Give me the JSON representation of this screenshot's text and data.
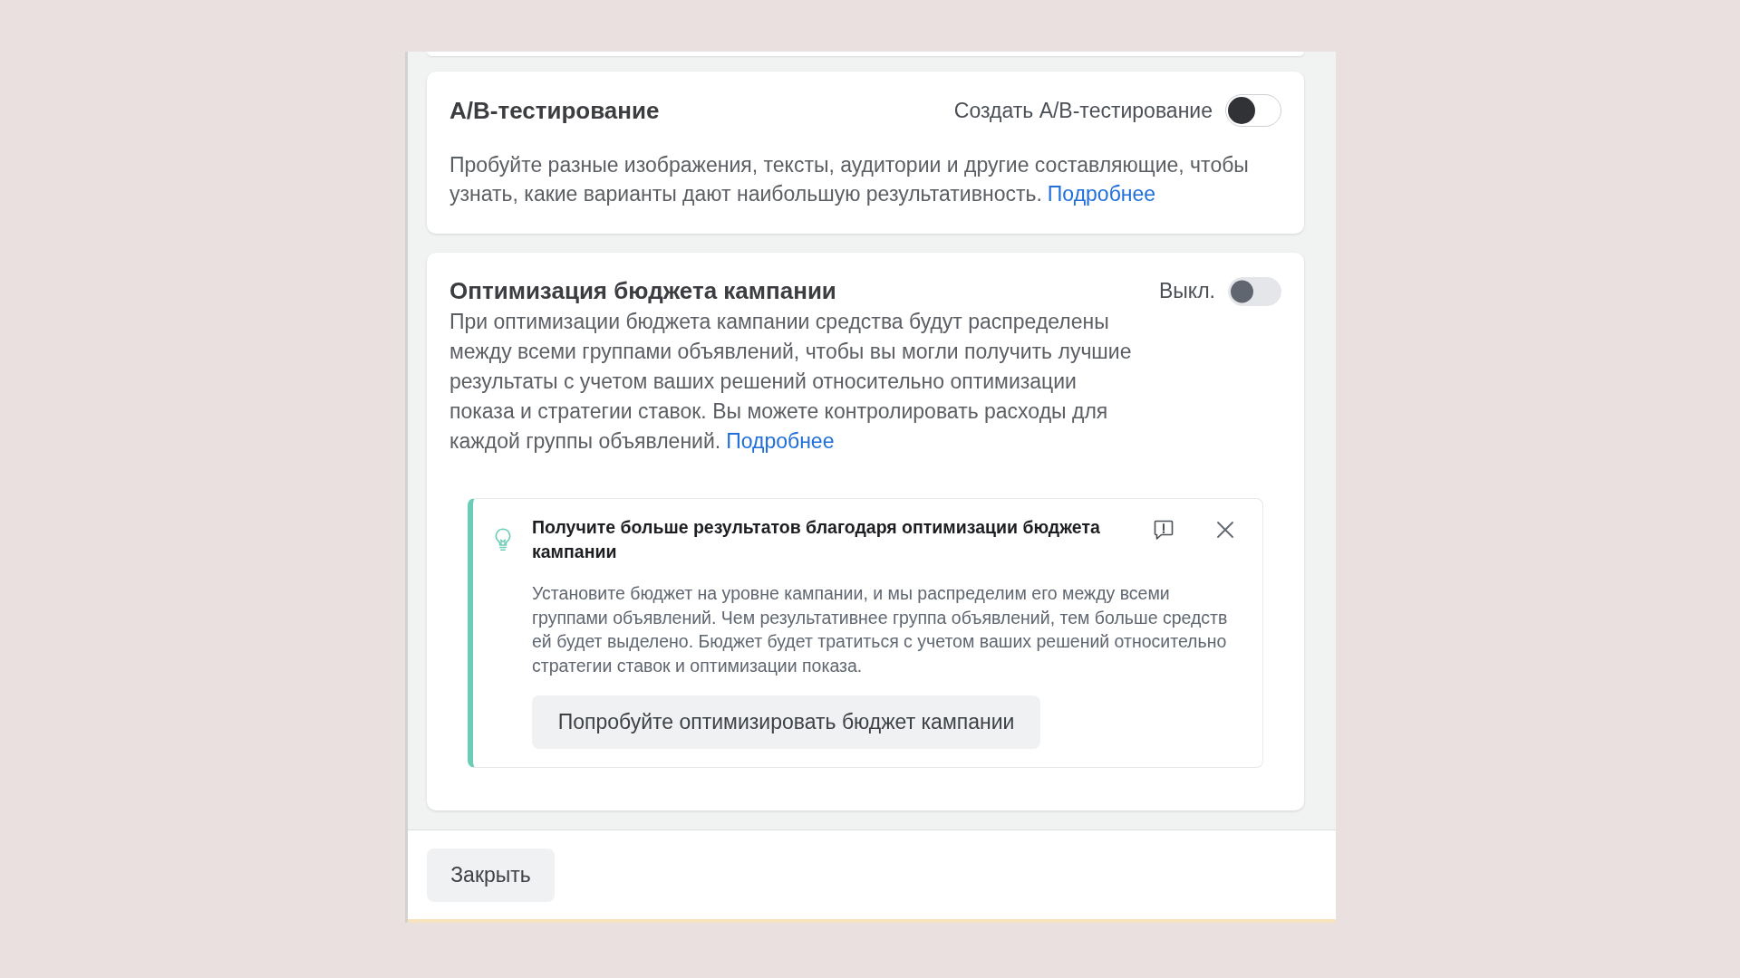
{
  "sections": [
    {
      "kind": "header_row",
      "title": "А/В-тестирование",
      "toggle_label": "Создать А/В-тестирование",
      "toggle_on": false,
      "disabled": false,
      "description": "Пробуйте разные изображения, тексты, аудитории и другие составляющие, чтобы узнать, какие варианты дают наибольшую результативность.",
      "link": "Подробнее"
    },
    {
      "kind": "side_toggle",
      "title": "Оптимизация бюджета кампании",
      "toggle_label": "Выкл.",
      "toggle_on": false,
      "disabled": true,
      "description": "При оптимизации бюджета кампании средства будут распределены между всеми группами объявлений, чтобы вы могли получить лучшие результаты с учетом ваших решений относительно оптимизации показа и стратегии ставок. Вы можете контролировать расходы для каждой группы объявлений.",
      "link": "Подробнее",
      "tip": {
        "title": "Получите больше результатов благодаря оптимизации бюджета кампании",
        "body": "Установите бюджет на уровне кампании, и мы распределим его между всеми группами объявлений. Чем результативнее группа объявлений, тем больше средств ей будет выделено. Бюджет будет тратиться с учетом ваших решений относительно стратегии ставок и оптимизации показа.",
        "button": "Попробуйте оптимизировать бюджет кампании"
      }
    }
  ],
  "footer": {
    "close_button": "Закрыть"
  }
}
